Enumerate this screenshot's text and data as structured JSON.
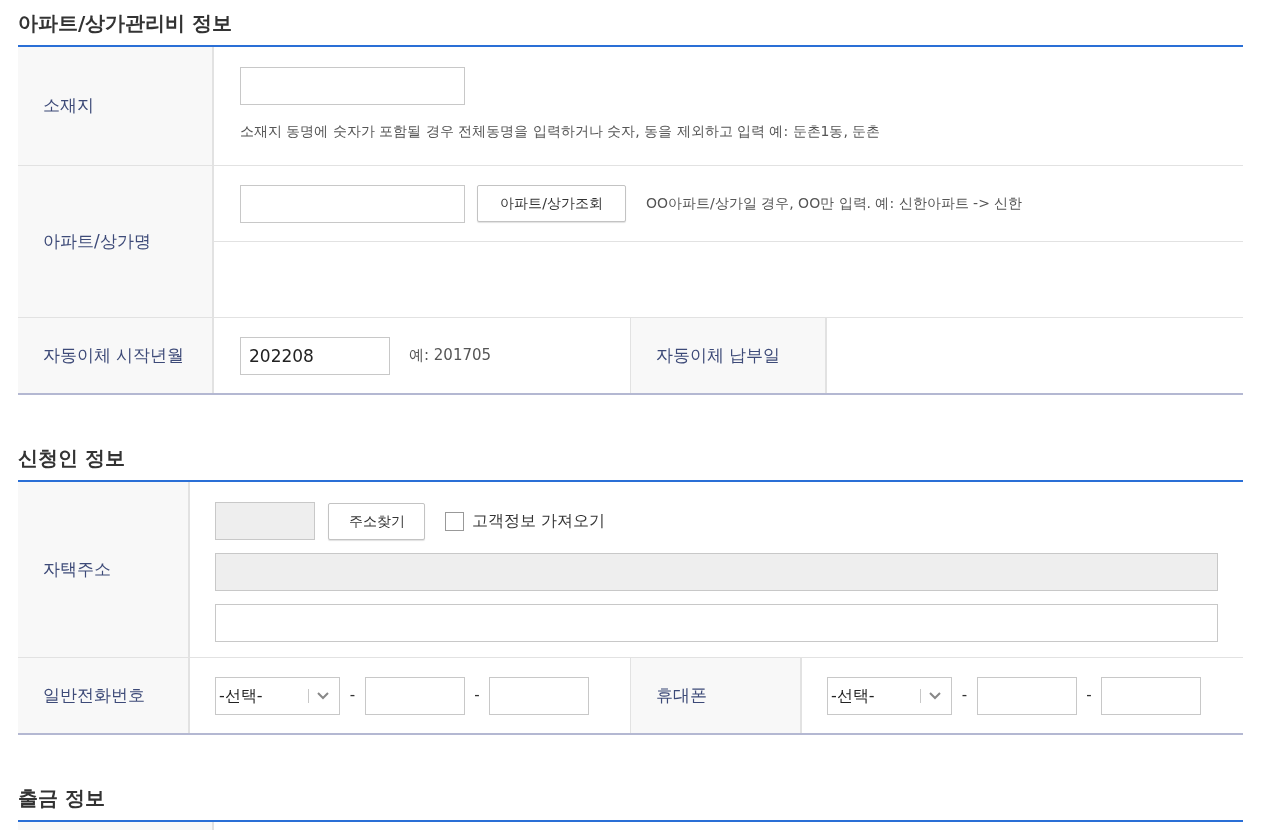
{
  "apartment_section": {
    "title": "아파트/상가관리비 정보",
    "location": {
      "label": "소재지",
      "hint": "소재지 동명에 숫자가 포함될 경우 전체동명을 입력하거나 숫자, 동을 제외하고 입력 예: 둔촌1동, 둔촌"
    },
    "apartment_name": {
      "label": "아파트/상가명",
      "search_button": "아파트/상가조회",
      "hint": "OO아파트/상가일 경우, OO만 입력. 예: 신한아파트 -> 신한"
    },
    "start_month": {
      "label": "자동이체 시작년월",
      "value": "202208",
      "example": "예: 201705"
    },
    "payment_day": {
      "label": "자동이체 납부일"
    }
  },
  "applicant_section": {
    "title": "신청인 정보",
    "home_address": {
      "label": "자택주소",
      "postcode": {
        "disabled": true
      },
      "search_button": "주소찾기",
      "import_checkbox": {
        "label": "고객정보 가져오기",
        "checked": false
      },
      "address_line": {
        "disabled": true
      },
      "detail_line": {
        "disabled": false
      }
    },
    "phones": [
      {
        "label": "일반전화번호",
        "select": "-선택-",
        "separators": [
          "-",
          "-"
        ]
      },
      {
        "label": "휴대폰",
        "select": "-선택-",
        "separators": [
          "-",
          "-"
        ]
      }
    ]
  },
  "withdrawal_section": {
    "title": "출금 정보"
  }
}
